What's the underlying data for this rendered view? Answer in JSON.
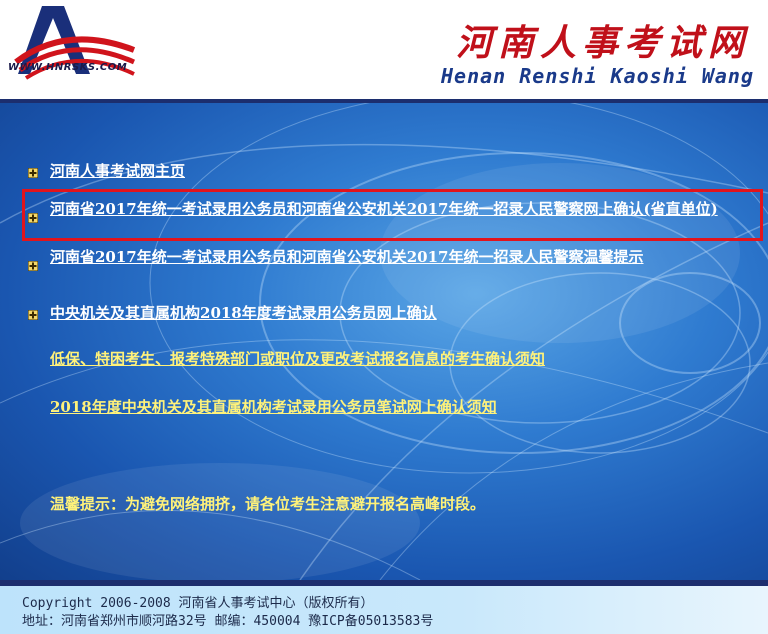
{
  "header": {
    "logo_url_text": "WWW.HNRSKS.COM",
    "title_cn": "河南人事考试网",
    "title_en": "Henan Renshi Kaoshi Wang"
  },
  "links": [
    {
      "label": "河南人事考试网主页",
      "color": "white",
      "bullet": true
    },
    {
      "label": "河南省2017年统一考试录用公务员和河南省公安机关2017年统一招录人民警察网上确认(省直单位)",
      "color": "white",
      "bullet": true,
      "highlighted": true
    },
    {
      "label": "河南省2017年统一考试录用公务员和河南省公安机关2017年统一招录人民警察温馨提示",
      "color": "white",
      "bullet": true
    },
    {
      "label": "中央机关及其直属机构2018年度考试录用公务员网上确认",
      "color": "white",
      "bullet": true
    },
    {
      "label": "低保、特困考生、报考特殊部门或职位及更改考试报名信息的考生确认须知",
      "color": "yellow",
      "bullet": false
    },
    {
      "label": "2018年度中央机关及其直属机构考试录用公务员笔试网上确认须知",
      "color": "yellow",
      "bullet": false
    }
  ],
  "tip": "温馨提示：为避免网络拥挤，请各位考生注意避开报名高峰时段。",
  "footer": {
    "copyright": "Copyright 2006-2008 河南省人事考试中心（版权所有）",
    "address": "地址：河南省郑州市顺河路32号 邮编：450004 豫ICP备05013583号"
  },
  "colors": {
    "highlight_border": "#e2141c",
    "link_white": "#ffffff",
    "link_yellow": "#fff27a",
    "title_red": "#c0101a",
    "title_blue": "#1a3a8a"
  }
}
